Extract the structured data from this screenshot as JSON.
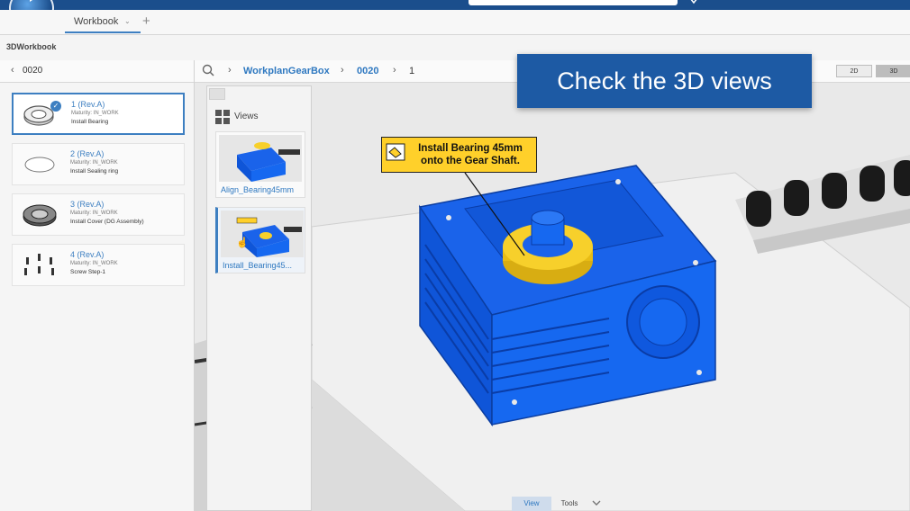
{
  "app": {
    "title": "3DWorkbook"
  },
  "tabs": [
    {
      "label": "Workbook"
    }
  ],
  "left_panel": {
    "header": "0020",
    "operations": [
      {
        "name": "1  (Rev.A)",
        "maturity": "Maturity: IN_WORK",
        "description": "Install Bearing",
        "selected": true
      },
      {
        "name": "2  (Rev.A)",
        "maturity": "Maturity: IN_WORK",
        "description": "Install Sealing ring"
      },
      {
        "name": "3  (Rev.A)",
        "maturity": "Maturity: IN_WORK",
        "description": "Install Cover (DG Assembly)"
      },
      {
        "name": "4  (Rev.A)",
        "maturity": "Maturity: IN_WORK",
        "description": "Screw Step-1"
      }
    ]
  },
  "breadcrumb": {
    "items": [
      "WorkplanGearBox",
      "0020",
      "1"
    ]
  },
  "view_mode": {
    "options": [
      "2D",
      "3D"
    ],
    "active": "3D"
  },
  "views_panel": {
    "title": "Views",
    "views": [
      {
        "caption": "Align_Bearing45mm"
      },
      {
        "caption": "Install_Bearing45..."
      }
    ]
  },
  "banner": {
    "text": "Check the 3D views"
  },
  "callout": {
    "text": "Install Bearing 45mm onto the Gear Shaft."
  },
  "bottom_tabs": {
    "items": [
      "View",
      "Tools"
    ],
    "active": "View"
  },
  "colors": {
    "brand": "#1b4e8c",
    "accent": "#2e78c0",
    "part": "#1565e8",
    "bearing": "#f2c61a",
    "callout_bg": "#ffd02a"
  },
  "icons": [
    "logo-icon",
    "search-icon",
    "check-icon",
    "views-grid-icon",
    "callout-icon",
    "chevron-down-icon",
    "add-tab-icon"
  ]
}
